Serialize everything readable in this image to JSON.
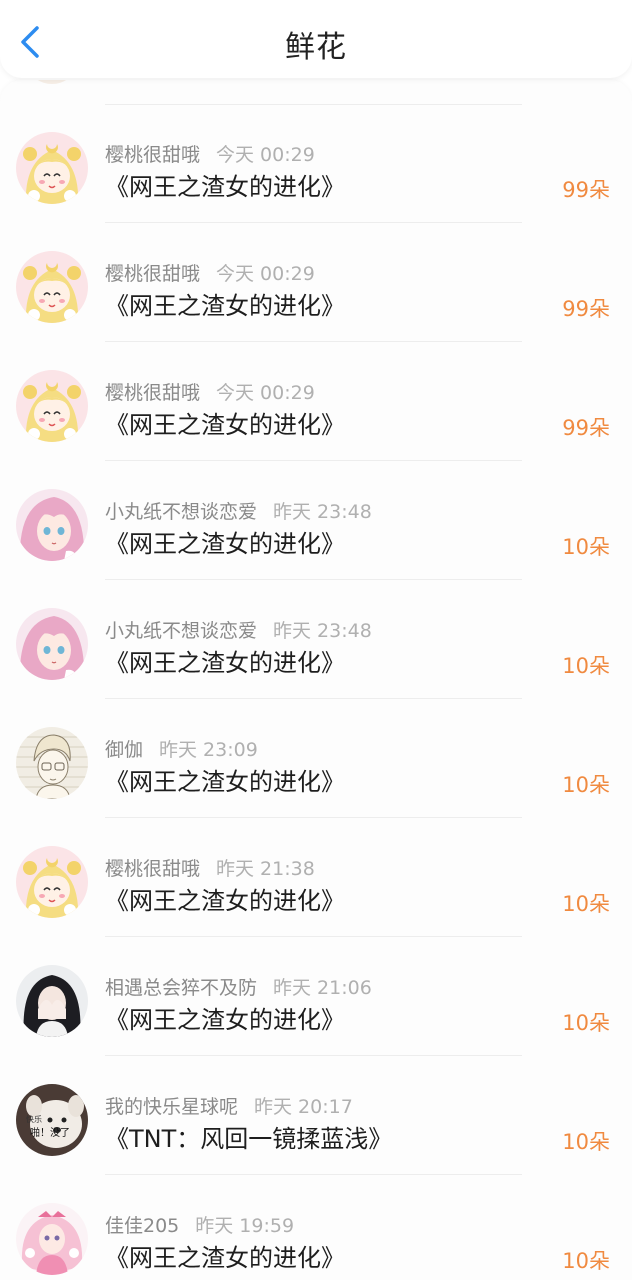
{
  "header": {
    "title": "鲜花",
    "back_icon": "chevron-left-icon",
    "accent": "#2d8cf0"
  },
  "colors": {
    "count": "#f08a40",
    "name": "#8a8a8a",
    "time": "#b0b0b0"
  },
  "items": [
    {
      "name": "樱桃很甜哦",
      "time": "今天 00:29",
      "work": "《网王之渣女的进化》",
      "count": "99朵",
      "avatar": "sailor-moon-avatar"
    },
    {
      "name": "樱桃很甜哦",
      "time": "今天 00:29",
      "work": "《网王之渣女的进化》",
      "count": "99朵",
      "avatar": "sailor-moon-avatar"
    },
    {
      "name": "樱桃很甜哦",
      "time": "今天 00:29",
      "work": "《网王之渣女的进化》",
      "count": "99朵",
      "avatar": "sailor-moon-avatar"
    },
    {
      "name": "小丸纸不想谈恋爱",
      "time": "昨天 23:48",
      "work": "《网王之渣女的进化》",
      "count": "10朵",
      "avatar": "anime-girl-pink-hair-avatar"
    },
    {
      "name": "小丸纸不想谈恋爱",
      "time": "昨天 23:48",
      "work": "《网王之渣女的进化》",
      "count": "10朵",
      "avatar": "anime-girl-pink-hair-avatar"
    },
    {
      "name": "御伽",
      "time": "昨天 23:09",
      "work": "《网王之渣女的进化》",
      "count": "10朵",
      "avatar": "sketch-boy-avatar"
    },
    {
      "name": "樱桃很甜哦",
      "time": "昨天 21:38",
      "work": "《网王之渣女的进化》",
      "count": "10朵",
      "avatar": "sailor-moon-avatar"
    },
    {
      "name": "相遇总会猝不及防",
      "time": "昨天 21:06",
      "work": "《网王之渣女的进化》",
      "count": "10朵",
      "avatar": "girl-covering-face-avatar"
    },
    {
      "name": "我的快乐星球呢",
      "time": "昨天 20:17",
      "work": "《TNT：风回一镜揉蓝浅》",
      "count": "10朵",
      "avatar": "dog-meme-avatar",
      "avatar_text": "快乐 啪！没了"
    },
    {
      "name": "佳佳205",
      "time": "昨天 19:59",
      "work": "《网王之渣女的进化》",
      "count": "10朵",
      "avatar": "lolita-doll-avatar"
    }
  ]
}
